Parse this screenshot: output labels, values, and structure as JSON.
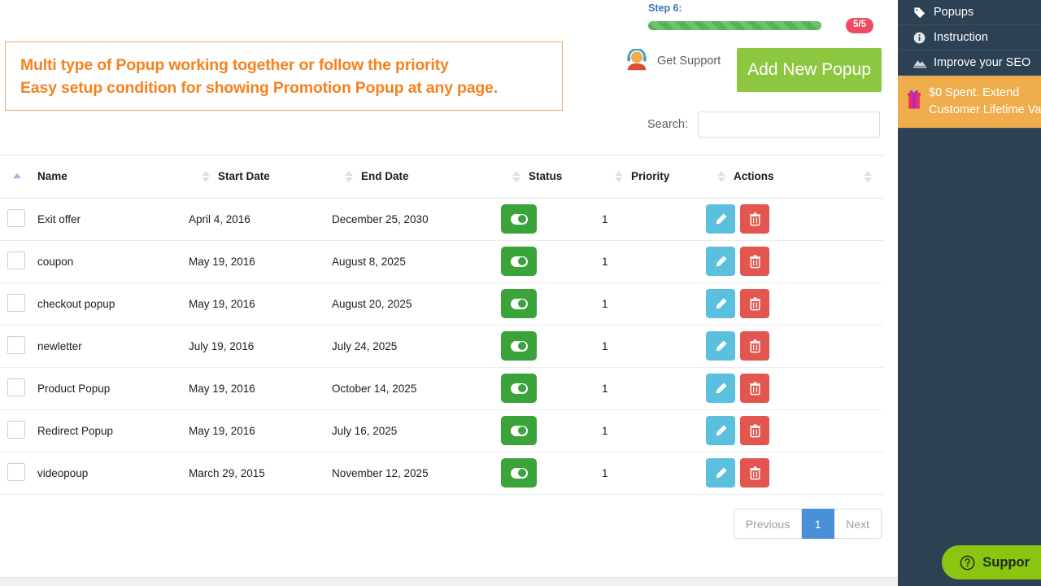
{
  "promo": {
    "line1": "Multi type of Popup working together or follow the priority",
    "line2": "Easy setup condition for showing Promotion Popup at any page.",
    "color": "#f5821f"
  },
  "progress": {
    "step_label": "Step 6:",
    "badge": "5/5",
    "percent": 100,
    "bar_color": "#55b455",
    "badge_color": "#ef4c61",
    "label_color": "#3a72b8"
  },
  "header_actions": {
    "support_label": "Get Support",
    "support_icon": "support-agent-avatar-icon",
    "add_button_label": "Add New Popup",
    "add_button_color": "#8dc63f"
  },
  "search": {
    "label": "Search:",
    "value": "",
    "placeholder": ""
  },
  "table": {
    "columns": [
      {
        "label": "",
        "sort": "asc",
        "key": "select"
      },
      {
        "label": "Name",
        "sort": "none",
        "key": "name"
      },
      {
        "label": "Start Date",
        "sort": "none",
        "key": "start_date"
      },
      {
        "label": "End Date",
        "sort": "none",
        "key": "end_date"
      },
      {
        "label": "Status",
        "sort": "none",
        "key": "status"
      },
      {
        "label": "Priority",
        "sort": "none",
        "key": "priority"
      },
      {
        "label": "Actions",
        "sort": "none",
        "key": "actions"
      }
    ],
    "rows": [
      {
        "name": "Exit offer",
        "start_date": "April 4, 2016",
        "end_date": "December 25, 2030",
        "status": "on",
        "priority": "1"
      },
      {
        "name": "coupon",
        "start_date": "May 19, 2016",
        "end_date": "August 8, 2025",
        "status": "on",
        "priority": "1"
      },
      {
        "name": "checkout popup",
        "start_date": "May 19, 2016",
        "end_date": "August 20, 2025",
        "status": "on",
        "priority": "1"
      },
      {
        "name": "newletter",
        "start_date": "July 19, 2016",
        "end_date": "July 24, 2025",
        "status": "on",
        "priority": "1"
      },
      {
        "name": "Product Popup",
        "start_date": "May 19, 2016",
        "end_date": "October 14, 2025",
        "status": "on",
        "priority": "1"
      },
      {
        "name": "Redirect Popup",
        "start_date": "May 19, 2016",
        "end_date": "July 16, 2025",
        "status": "on",
        "priority": "1"
      },
      {
        "name": "videopoup",
        "start_date": "March 29, 2015",
        "end_date": "November 12, 2025",
        "status": "on",
        "priority": "1"
      }
    ],
    "row_actions": {
      "edit_icon": "pencil-icon",
      "edit_color": "#5bc0de",
      "delete_icon": "trash-icon",
      "delete_color": "#e2564f"
    },
    "toggle_color": "#3aa43a"
  },
  "pagination": {
    "previous": "Previous",
    "current_page": "1",
    "next": "Next",
    "active_color": "#4a90d9"
  },
  "sidebar": {
    "background": "#2d4154",
    "items": [
      {
        "label": "Popups",
        "icon": "tag-icon"
      },
      {
        "label": "Instruction",
        "icon": "info-circle-icon"
      },
      {
        "label": "Improve your SEO",
        "icon": "chart-mountain-icon"
      }
    ],
    "promo": {
      "line1": "$0 Spent. Extend",
      "line2": "Customer Lifetime Val",
      "icon": "gift-icon",
      "background": "#f0ad4e"
    }
  },
  "support_widget": {
    "label": "Suppor",
    "icon": "question-circle-icon",
    "color": "#8cc412"
  }
}
